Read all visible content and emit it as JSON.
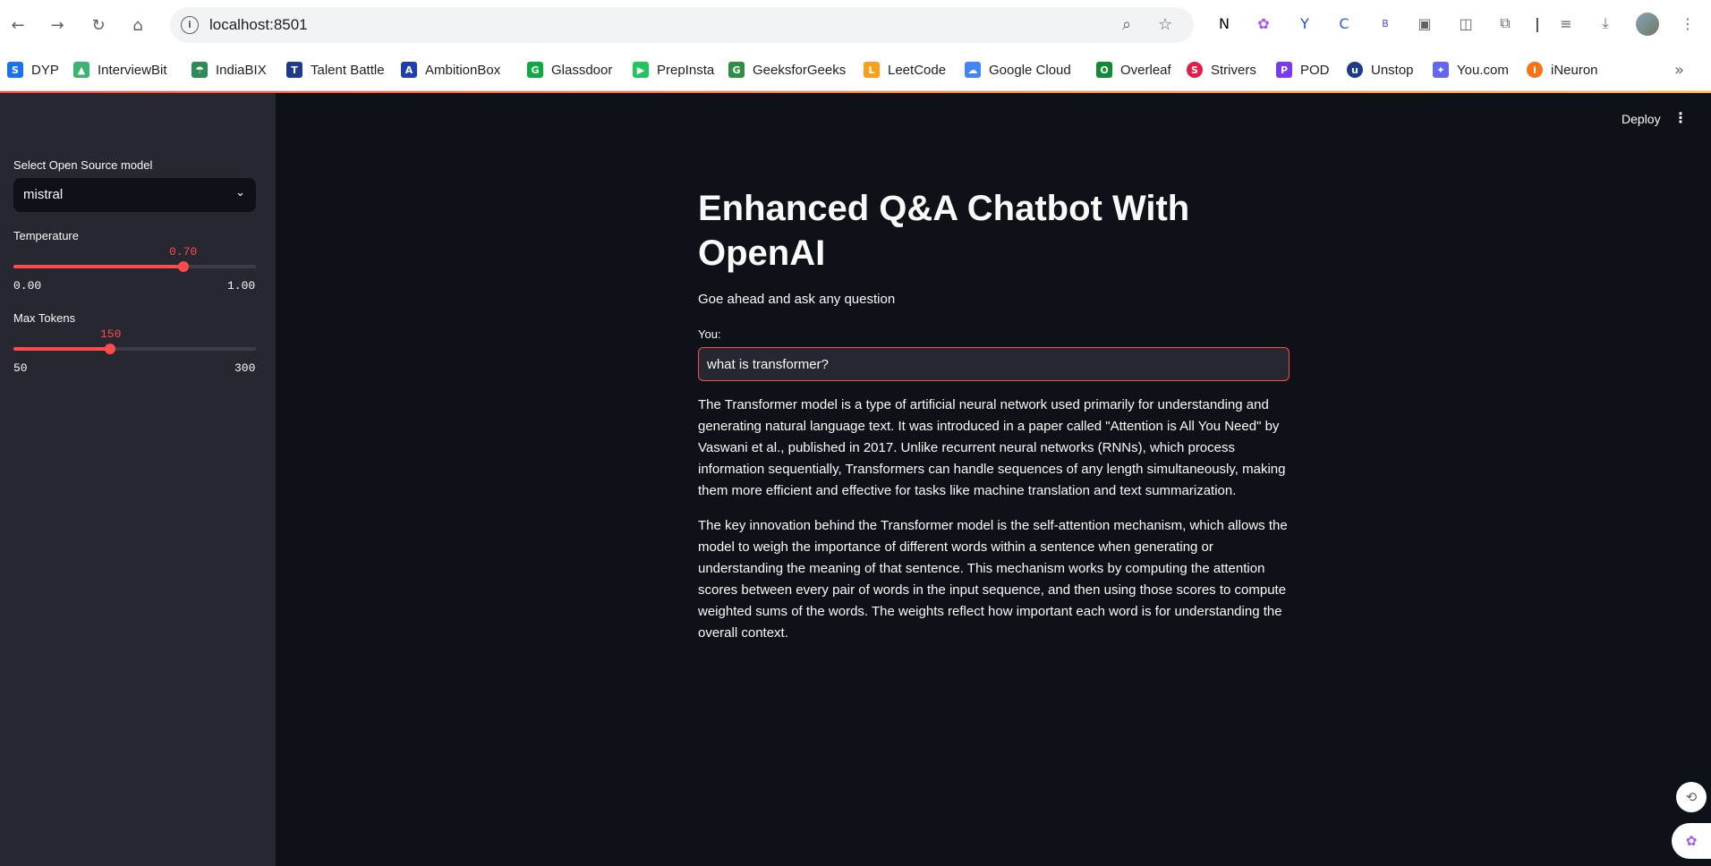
{
  "browser": {
    "url": "localhost:8501",
    "bookmarks": [
      {
        "label": "DYP",
        "icon": "dyp-icon",
        "color": "#1a73e8"
      },
      {
        "label": "InterviewBit",
        "icon": "interviewbit-icon",
        "color": "#3cb371"
      },
      {
        "label": "IndiaBIX",
        "icon": "indiabix-icon",
        "color": "#2e8b57"
      },
      {
        "label": "Talent Battle",
        "icon": "talent-battle-icon",
        "color": "#1e3a8a"
      },
      {
        "label": "AmbitionBox",
        "icon": "ambitionbox-icon",
        "color": "#1e40af"
      },
      {
        "label": "Glassdoor",
        "icon": "glassdoor-icon",
        "color": "#0caa41"
      },
      {
        "label": "PrepInsta",
        "icon": "prepinsta-icon",
        "color": "#22c55e"
      },
      {
        "label": "GeeksforGeeks",
        "icon": "geeksforgeeks-icon",
        "color": "#2f8d46"
      },
      {
        "label": "LeetCode",
        "icon": "leetcode-icon",
        "color": "#f89f1b"
      },
      {
        "label": "Google Cloud",
        "icon": "google-cloud-icon",
        "color": "#4285f4"
      },
      {
        "label": "Overleaf",
        "icon": "overleaf-icon",
        "color": "#138a36"
      },
      {
        "label": "Strivers",
        "icon": "strivers-icon",
        "color": "#e11d48"
      },
      {
        "label": "POD",
        "icon": "pod-icon",
        "color": "#7c3aed"
      },
      {
        "label": "Unstop",
        "icon": "unstop-icon",
        "color": "#1e3a8a"
      },
      {
        "label": "You.com",
        "icon": "you-com-icon",
        "color": "#6366f1"
      },
      {
        "label": "iNeuron",
        "icon": "ineuron-icon",
        "color": "#f97316"
      }
    ]
  },
  "sidebar": {
    "model_label": "Select Open Source model",
    "model_value": "mistral",
    "temperature": {
      "label": "Temperature",
      "value": "0.70",
      "min": "0.00",
      "max": "1.00",
      "fraction": 0.7
    },
    "max_tokens": {
      "label": "Max Tokens",
      "value": "150",
      "min": "50",
      "max": "300",
      "fraction": 0.4
    }
  },
  "header": {
    "deploy_label": "Deploy",
    "menu_label": "⋮"
  },
  "main": {
    "title": "Enhanced Q&A Chatbot With OpenAI",
    "subtitle": "Goe ahead and ask any question",
    "input_label": "You:",
    "input_value": "what is transformer?",
    "answer_p1": "The Transformer model is a type of artificial neural network used primarily for understanding and generating natural language text. It was introduced in a paper called \"Attention is All You Need\" by Vaswani et al., published in 2017. Unlike recurrent neural networks (RNNs), which process information sequentially, Transformers can handle sequences of any length simultaneously, making them more efficient and effective for tasks like machine translation and text summarization.",
    "answer_p2": "The key innovation behind the Transformer model is the self-attention mechanism, which allows the model to weigh the importance of different words within a sentence when generating or understanding the meaning of that sentence. This mechanism works by computing the attention scores between every pair of words in the input sequence, and then using those scores to compute weighted sums of the words. The weights reflect how important each word is for understanding the overall context."
  }
}
